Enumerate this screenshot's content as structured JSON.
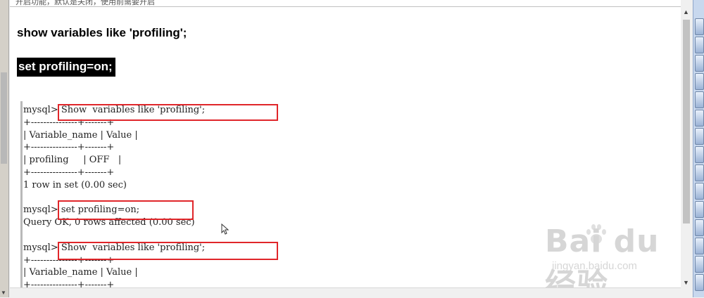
{
  "top_note": "开启功能，默认是关闭，使用前需要开启",
  "heading_query": "show variables like 'profiling';",
  "heading_set": "set profiling=on;",
  "console_lines": [
    "mysql> Show  variables like 'profiling';",
    "+---------------+-------+",
    "| Variable_name | Value |",
    "+---------------+-------+",
    "| profiling     | OFF   |",
    "+---------------+-------+",
    "1 row in set (0.00 sec)",
    "",
    "mysql> set profiling=on;",
    "Query OK, 0 rows affected (0.00 sec)",
    "",
    "mysql> Show  variables like 'profiling';",
    "+---------------+-------+",
    "| Variable_name | Value |",
    "+---------------+-------+"
  ],
  "watermark": {
    "logo": "Bai du 经验",
    "url": "jingyan.baidu.com"
  },
  "colors": {
    "highlight_box": "#e0262a",
    "heading_background": "#000000",
    "heading_text": "#ffffff"
  },
  "icons": [
    "scroll-up-icon",
    "scroll-down-icon",
    "mouse-cursor-icon",
    "baidu-paw-icon"
  ]
}
